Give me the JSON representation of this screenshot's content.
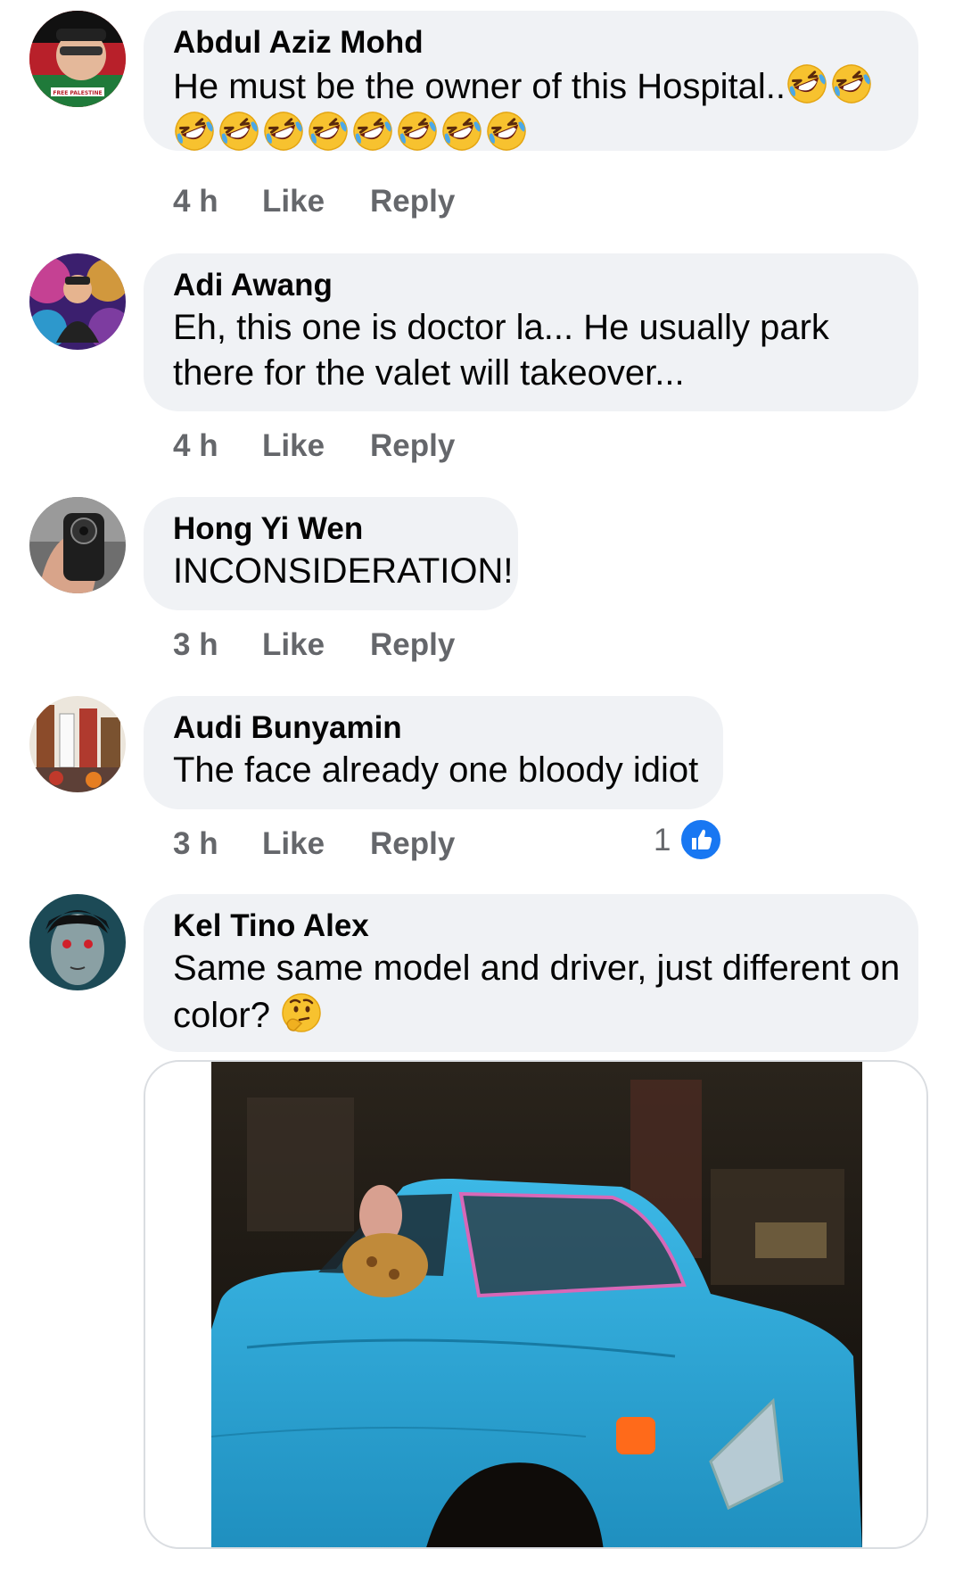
{
  "comments": [
    {
      "author": "Abdul Aziz Mohd",
      "text_line1": "He must be the owner of this Hospital..",
      "time": "4 h",
      "like_label": "Like",
      "reply_label": "Reply",
      "avatar_badge_text": "FREE PALESTINE"
    },
    {
      "author": "Adi Awang",
      "text_line1": "Eh, this one is doctor la... He usually park",
      "text_line2": "there for the valet will takeover...",
      "time": "4 h",
      "like_label": "Like",
      "reply_label": "Reply"
    },
    {
      "author": "Hong Yi Wen",
      "text_line1": "INCONSIDERATION!",
      "time": "3 h",
      "like_label": "Like",
      "reply_label": "Reply"
    },
    {
      "author": "Audi Bunyamin",
      "text_line1": "The face already one bloody idiot",
      "time": "3 h",
      "like_label": "Like",
      "reply_label": "Reply",
      "reaction_count": "1"
    },
    {
      "author": "Kel Tino Alex",
      "text_line1": "Same same model and driver, just different on",
      "text_line2": "color?",
      "time": "",
      "like_label": "",
      "reply_label": ""
    }
  ],
  "icons": {
    "laugh_emoji": "rolling-on-floor-laughing-icon",
    "thinking_emoji": "thinking-face-icon",
    "like_reaction": "thumbs-up-icon"
  },
  "colors": {
    "bubble": "#f0f2f5",
    "meta_text": "#65676b",
    "like_blue": "#1877f2",
    "car_blue": "#2aa7d6"
  }
}
